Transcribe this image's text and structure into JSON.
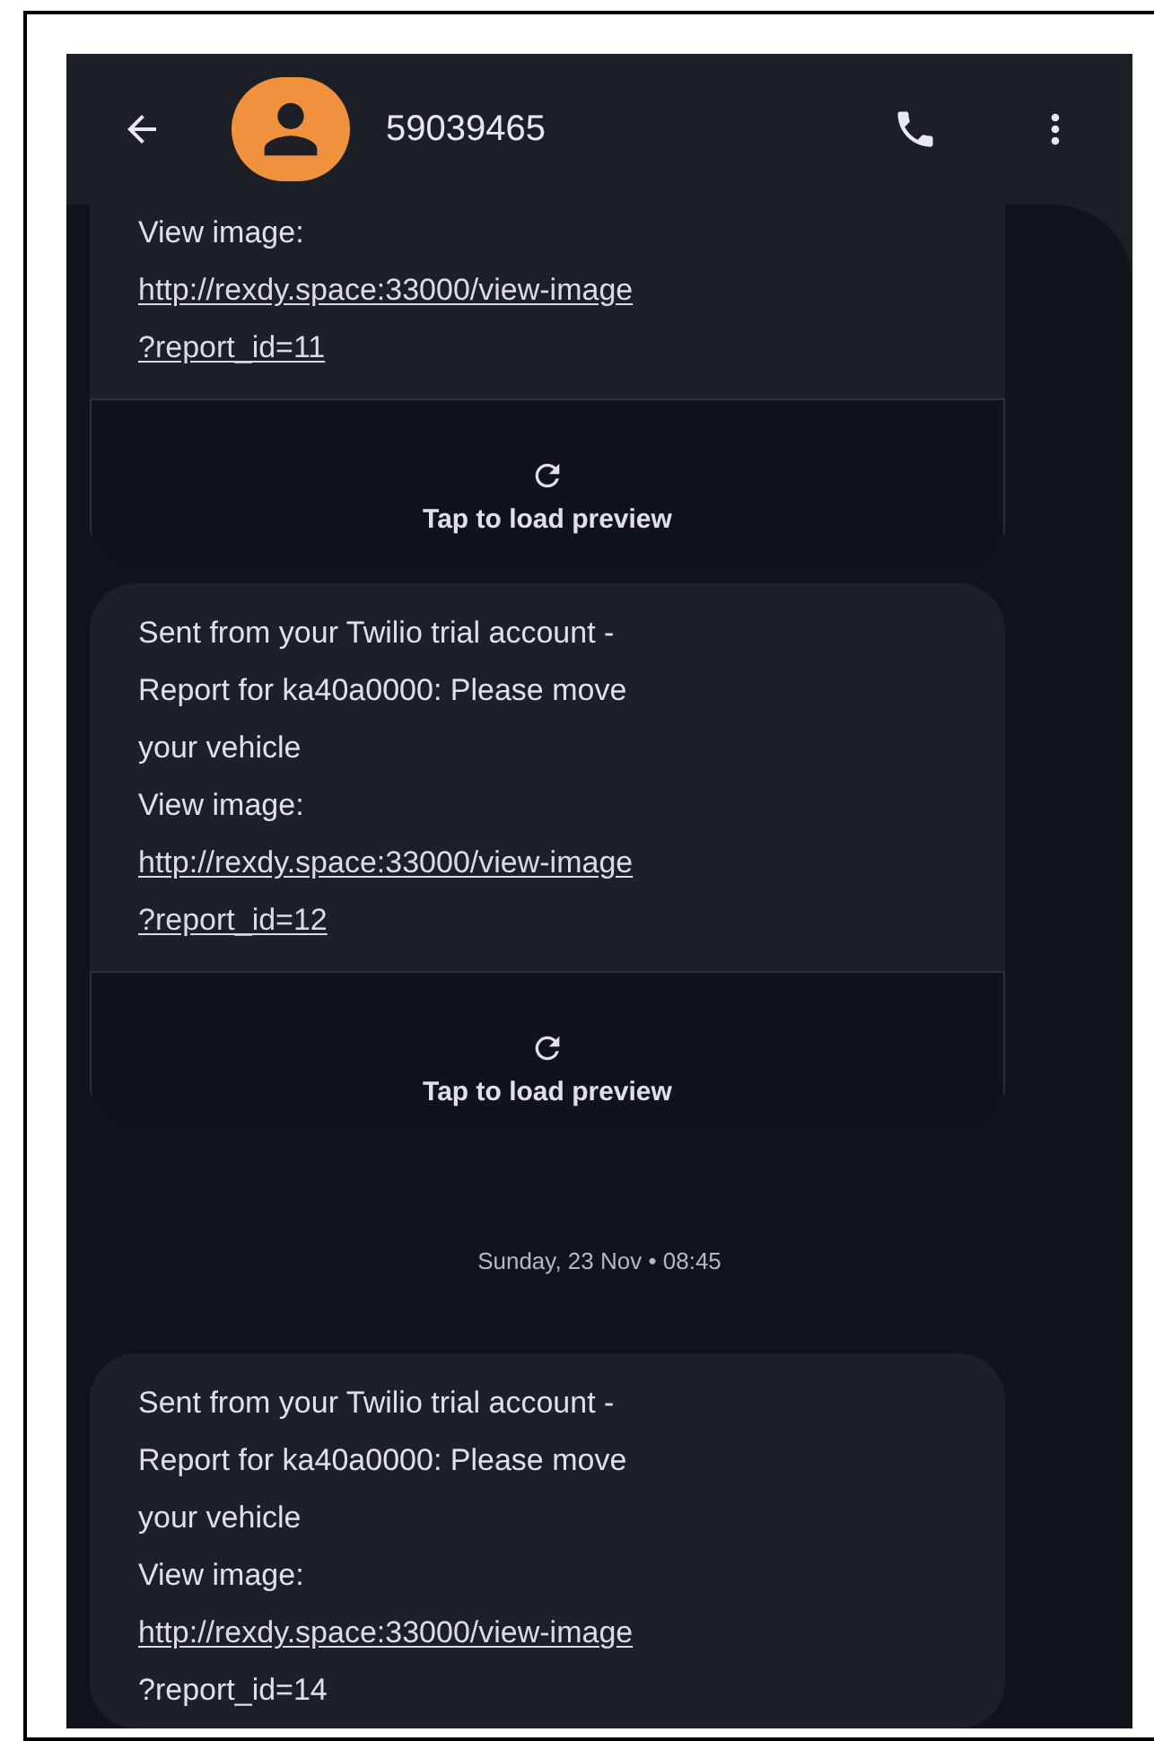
{
  "header": {
    "title": "59039465"
  },
  "feed": [
    {
      "kind": "message",
      "cut_top": true,
      "lines": [
        {
          "kind": "text",
          "text": "View image:"
        },
        {
          "kind": "link",
          "text": "http://rexdy.space:33000/view-image"
        },
        {
          "kind": "link",
          "text": "?report_id=11"
        }
      ],
      "preview": {
        "label": "Tap to load preview"
      }
    },
    {
      "kind": "message",
      "cut_top": false,
      "lines": [
        {
          "kind": "text",
          "text": "Sent from your Twilio trial account -"
        },
        {
          "kind": "text",
          "text": "Report for ka40a0000: Please move"
        },
        {
          "kind": "text",
          "text": "your vehicle"
        },
        {
          "kind": "text",
          "text": "View image:"
        },
        {
          "kind": "link",
          "text": "http://rexdy.space:33000/view-image"
        },
        {
          "kind": "link",
          "text": "?report_id=12"
        }
      ],
      "preview": {
        "label": "Tap to load preview"
      }
    },
    {
      "kind": "date",
      "text": "Sunday, 23 Nov • 08:45"
    },
    {
      "kind": "message",
      "cut_top": false,
      "lines": [
        {
          "kind": "text",
          "text": "Sent from your Twilio trial account -"
        },
        {
          "kind": "text",
          "text": "Report for ka40a0000: Please move"
        },
        {
          "kind": "text",
          "text": "your vehicle"
        },
        {
          "kind": "text",
          "text": "View image:"
        },
        {
          "kind": "link",
          "text": "http://rexdy.space:33000/view-image"
        },
        {
          "kind": "text",
          "text": "?report_id=14"
        }
      ]
    }
  ]
}
